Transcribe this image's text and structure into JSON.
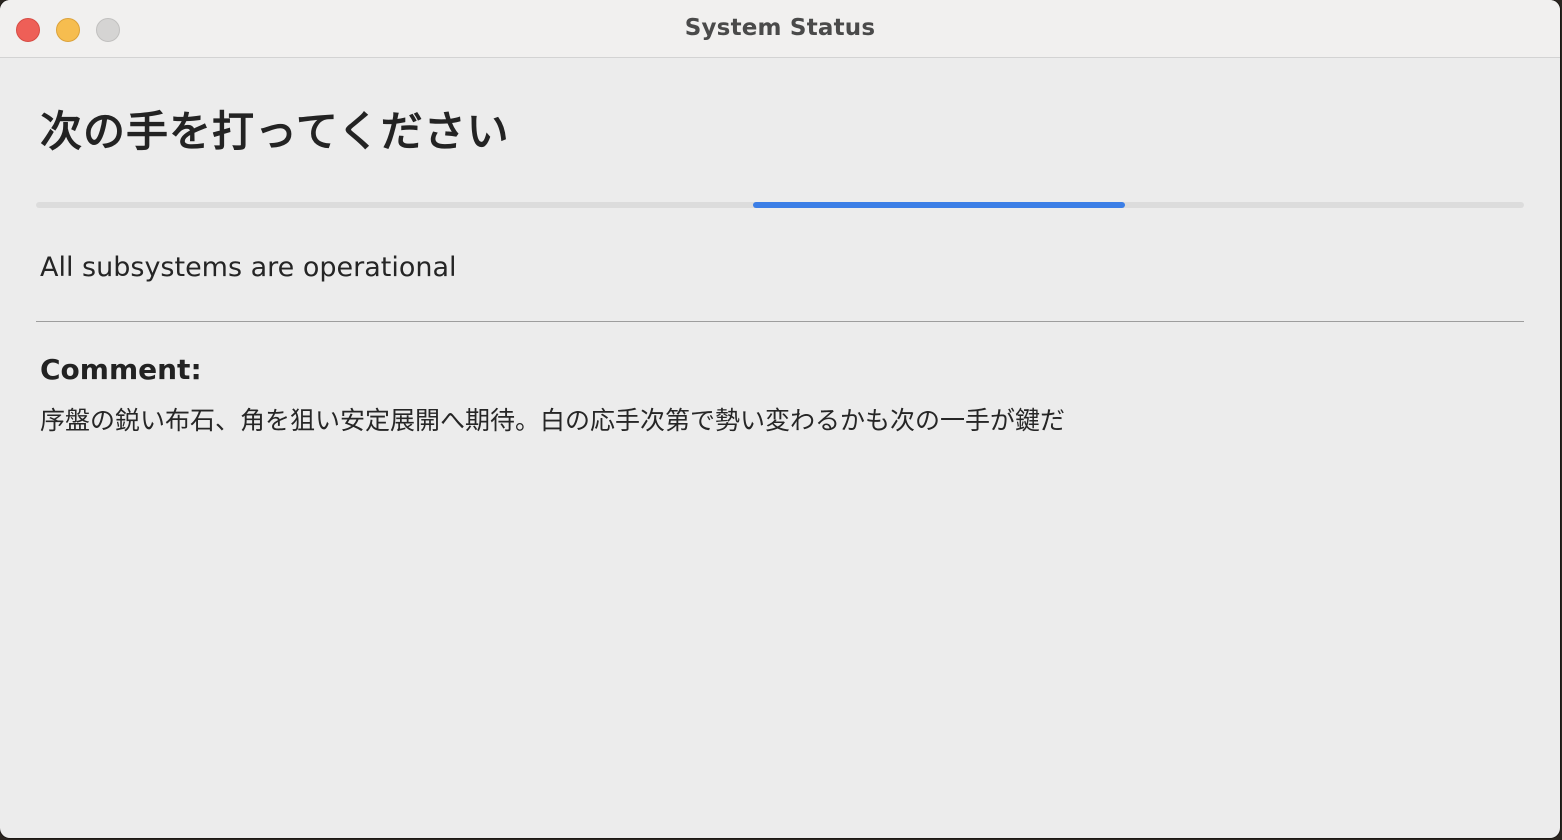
{
  "window": {
    "title": "System Status"
  },
  "main": {
    "heading": "次の手を打ってください",
    "progress": {
      "style": "indeterminate",
      "accent_color": "#3b7ee6"
    },
    "status_text": "All subsystems are operational",
    "comment": {
      "label": "Comment:",
      "text": "序盤の鋭い布石、角を狙い安定展開へ期待。白の応手次第で勢い変わるかも次の一手が鍵だ"
    }
  },
  "icons": {
    "close": "close-button-red",
    "minimize": "minimize-button-yellow",
    "zoom": "zoom-button-gray"
  }
}
